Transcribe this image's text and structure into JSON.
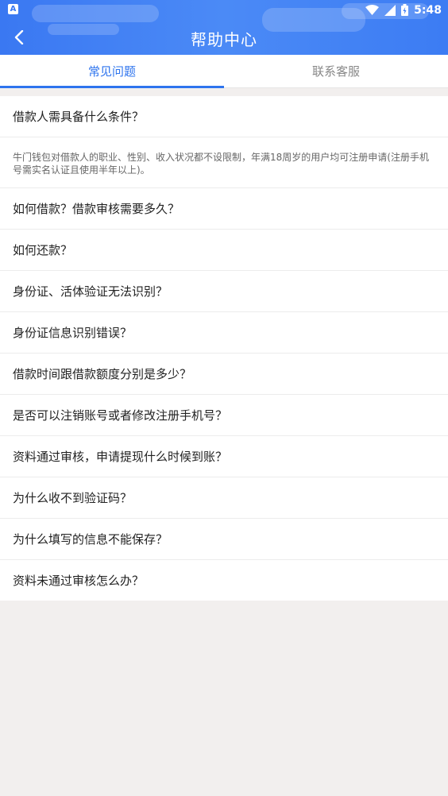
{
  "status_bar": {
    "left_icon_letter": "A",
    "time": "5:48",
    "icons": [
      "wifi-icon",
      "signal-icon",
      "battery-icon"
    ]
  },
  "nav": {
    "title": "帮助中心",
    "back_icon": "chevron-left-icon"
  },
  "tabs": [
    {
      "label": "常见问题",
      "active": true
    },
    {
      "label": "联系客服",
      "active": false
    }
  ],
  "faq": {
    "expanded": {
      "question": "借款人需具备什么条件？",
      "answer": "牛门钱包对借款人的职业、性别、收入状况都不设限制，年满18周岁的用户均可注册申请(注册手机号需实名认证且使用半年以上)。"
    },
    "items": [
      "如何借款？借款审核需要多久？",
      "如何还款？",
      "身份证、活体验证无法识别？",
      "身份证信息识别错误？",
      "借款时间跟借款额度分别是多少？",
      "是否可以注销账号或者修改注册手机号？",
      "资料通过审核，申请提现什么时候到账？",
      "为什么收不到验证码？",
      "为什么填写的信息不能保存？",
      "资料未通过审核怎么办？"
    ]
  },
  "colors": {
    "header_bg": "#3a78f2",
    "accent": "#2e74ee",
    "page_bg": "#f2efee"
  }
}
